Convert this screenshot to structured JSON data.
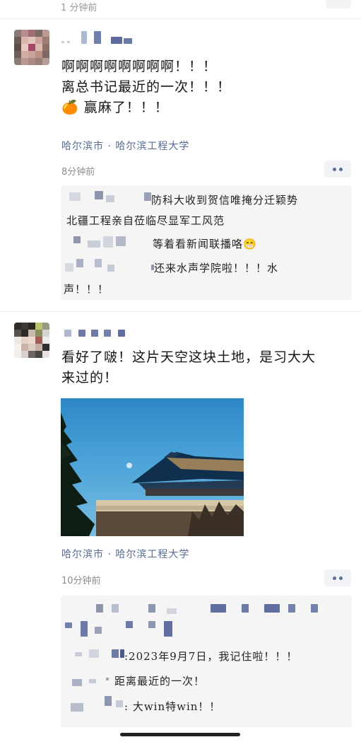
{
  "top": {
    "meta": "1 分钟前"
  },
  "posts": [
    {
      "text_lines": [
        "啊啊啊啊啊啊啊啊！！！",
        "离总书记最近的一次！！！",
        "🍊 赢麻了！！！"
      ],
      "location": "哈尔滨市 · 哈尔滨工程大学",
      "time": "8分钟前",
      "comments": [
        {
          "text": "防科大收到贺信唯掩分迁颖势"
        },
        {
          "text": "北疆工程亲自莅临尽显军工风范"
        },
        {
          "text": "等着看新闻联播咯😁"
        },
        {
          "text": "还来水声学院啦！！！水"
        },
        {
          "text": "声！！！"
        }
      ]
    },
    {
      "text_lines": [
        "看好了啵！这片天空这块土地，是习大大",
        "来过的！"
      ],
      "location": "哈尔滨市 · 哈尔滨工程大学",
      "time": "10分钟前",
      "photo_alt": "sky-and-palace-roof-photo",
      "comments": [
        {
          "text": ":2023年9月7日，我记住啦！！！"
        },
        {
          "text": "距离最近的一次！"
        },
        {
          "text": ": 大win特win！！"
        }
      ]
    }
  ]
}
